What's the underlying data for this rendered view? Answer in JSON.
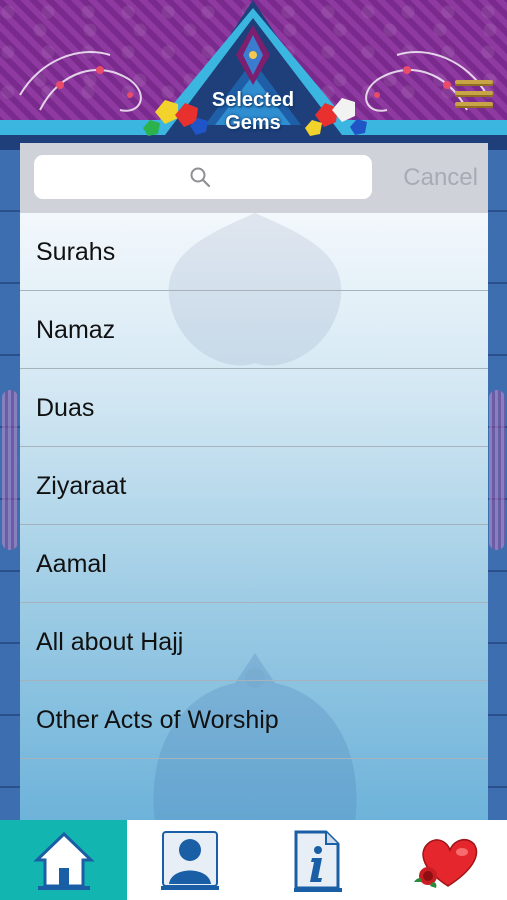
{
  "header": {
    "title_line1": "Selected",
    "title_line2": "Gems",
    "menu_icon": "hamburger-menu-icon"
  },
  "search": {
    "placeholder": "",
    "value": "",
    "cancel_label": "Cancel",
    "icon": "search-icon"
  },
  "list": {
    "items": [
      {
        "label": "Surahs"
      },
      {
        "label": "Namaz"
      },
      {
        "label": "Duas"
      },
      {
        "label": "Ziyaraat"
      },
      {
        "label": "Aamal"
      },
      {
        "label": "All about Hajj"
      },
      {
        "label": "Other Acts of Worship"
      }
    ]
  },
  "tabbar": {
    "tabs": [
      {
        "icon": "home-icon",
        "active": true
      },
      {
        "icon": "profile-icon",
        "active": false
      },
      {
        "icon": "info-icon",
        "active": false
      },
      {
        "icon": "heart-rose-icon",
        "active": false
      }
    ]
  },
  "colors": {
    "accent_tab": "#12b5b0",
    "background_purple": "#7a2a8c",
    "cancel_text": "#a7abb3"
  }
}
